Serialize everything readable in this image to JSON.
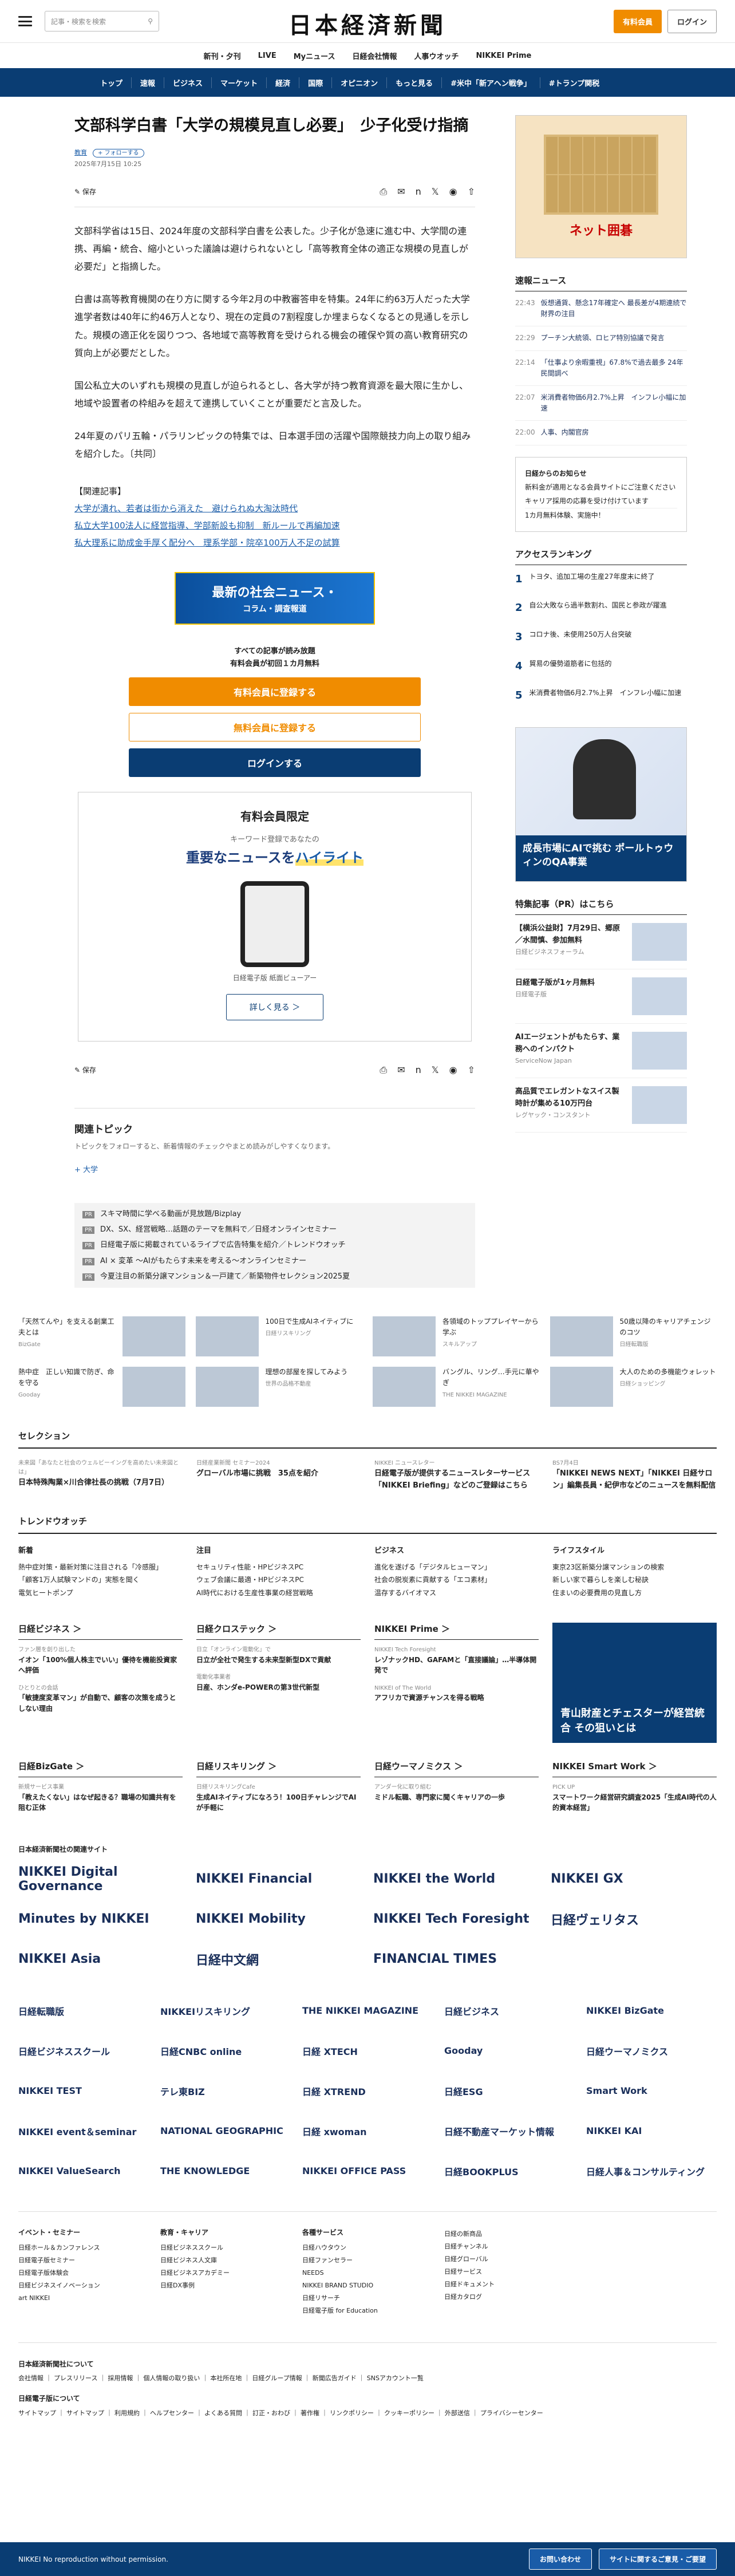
{
  "header": {
    "search_placeholder": "記事・検索を検索",
    "logo": "日本経済新聞",
    "signup": "有料会員",
    "login": "ログイン"
  },
  "subnav": [
    "新刊・夕刊",
    "LIVE",
    "Myニュース",
    "日経会社情報",
    "人事ウオッチ",
    "NIKKEI Prime"
  ],
  "mainnav": [
    "トップ",
    "速報",
    "ビジネス",
    "マーケット",
    "経済",
    "国際",
    "オピニオン",
    "もっと見る",
    "#米中「新アヘン戦争」",
    "#トランプ関税"
  ],
  "article": {
    "title": "文部科学白書「大学の規模見直し必要」　少子化受け指摘",
    "tag": "教育",
    "follow": "+ フォローする",
    "date": "2025年7月15日 10:25",
    "save": "保存",
    "paras": [
      "文部科学省は15日、2024年度の文部科学白書を公表した。少子化が急速に進む中、大学間の連携、再編・統合、縮小といった議論は避けられないとし「高等教育全体の適正な規模の見直しが必要だ」と指摘した。",
      "白書は高等教育機関の在り方に関する今年2月の中教審答申を特集。24年に約63万人だった大学進学者数は40年に約46万人となり、現在の定員の7割程度しか埋まらなくなるとの見通しを示した。規模の適正化を図りつつ、各地域で高等教育を受けられる機会の確保や質の高い教育研究の質向上が必要だとした。",
      "国公私立大のいずれも規模の見直しが迫られるとし、各大学が持つ教育資源を最大限に生かし、地域や設置者の枠組みを超えて連携していくことが重要だと言及した。",
      "24年夏のパリ五輪・パラリンピックの特集では、日本選手団の活躍や国際競技力向上の取り組みを紹介した。〔共同〕"
    ],
    "related_title": "【関連記事】",
    "related": [
      "大学が潰れ、若者は街から消えた　避けられぬ大淘汰時代",
      "私立大学100法人に経営指導、学部新設も抑制　新ルールで再編加速",
      "私大理系に助成金手厚く配分へ　理系学部・院卒100万人不足の試算"
    ]
  },
  "banner": {
    "title": "最新の社会ニュース・",
    "sub": "コラム・調査報道"
  },
  "paywall": {
    "line1": "すべての記事が読み放題",
    "line2": "有料会員が初回１カ月無料",
    "b1": "有料会員に登録する",
    "b2": "無料会員に登録する",
    "b3": "ログインする"
  },
  "digital": {
    "title": "有料会員限定",
    "sub": "キーワード登録であなたの",
    "hl1": "重要なニュースを",
    "hl2": "ハイライト",
    "cap": "日経電子版 紙面ビューアー",
    "more": "詳しく見る ＞"
  },
  "topics": {
    "title": "関連トピック",
    "desc": "トピックをフォローすると、新着情報のチェックやまとめ読みがしやすくなります。",
    "follow": "+ 大学"
  },
  "promos": [
    "スキマ時間に学べる動画が見放題/Bizplay",
    "DX、SX、経営戦略…話題のテーマを無料で／日経オンラインセミナー",
    "日経電子版に掲載されているライブで広告特集を紹介／トレンドウオッチ",
    "AI × 変革 ～AIがもたらす未来を考える～オンラインセミナー",
    "今夏注目の新築分譲マンション＆一戸建て／新築物件セレクション2025夏"
  ],
  "sidebar": {
    "ad1": "ネット囲碁",
    "news_title": "速報ニュース",
    "news": [
      [
        "22:43",
        "仮想通貨、懸念17年確定へ 最長差が4期連続で財界の注目"
      ],
      [
        "22:29",
        "プーチン大統領、ロヒア特別協議で発言"
      ],
      [
        "22:14",
        "「仕事より余暇重視」67.8%で過去最多 24年民間調べ"
      ],
      [
        "22:07",
        "米消費者物価6月2.7%上昇　インフレ小幅に加速"
      ],
      [
        "22:00",
        "人事、内閣官房"
      ]
    ],
    "notice": [
      "日経からのお知らせ",
      "新料金が適用となる会員サイトにご注意ください",
      "キャリア採用の応募を受け付けています",
      "1カ月無料体験、実施中！"
    ],
    "rank_title": "アクセスランキング",
    "rank": [
      "トヨタ、追加工場の生産27年度末に終了",
      "自公大敗なら過半数割れ、国民と参政が躍進",
      "コロナ後、未使用250万人台突破",
      "貿易の優勢道筋者に包括的",
      "米消費者物価6月2.7%上昇　インフレ小幅に加速"
    ],
    "ad2": "成長市場にAIで挑む ポールトゥウィンのQA事業",
    "pr_title": "特集記事（PR）はこちら",
    "pr": [
      [
        "【横浜公益財】7月29日、郷原／水間慎、参加無料",
        "日経ビジネスフォーラム"
      ],
      [
        "日経電子版が1ヶ月無料",
        "日経電子版"
      ],
      [
        "AIエージェントがもたらす、業務へのインパクト",
        "ServiceNow Japan"
      ],
      [
        "高品質でエレガントなスイス製時計が集める10万円台",
        "レグヤック・コンスタント"
      ]
    ]
  },
  "cards": [
    [
      "「天然てんや」を支える創業工夫とは",
      "BizGate"
    ],
    [
      "100日で生成AIネイティブに",
      "日経リスキリング"
    ],
    [
      "各領域のトッププレイヤーから学ぶ",
      "スキルアップ"
    ],
    [
      "50歳以降のキャリアチェンジのコツ",
      "日経転職版"
    ],
    [
      "熱中症　正しい知識で防ぎ、命を守る",
      "Gooday"
    ],
    [
      "理想の部屋を探してみよう",
      "世界の品格不動産"
    ],
    [
      "バングル、リング…手元に華やぎ",
      "THE NIKKEI MAGAZINE"
    ],
    [
      "大人のための多機能ウォレット",
      "日経ショッピング"
    ]
  ],
  "selection": {
    "title": "セレクション",
    "items": [
      [
        "未来図「あなたと社会のウェルビーイングを高めたい未来図とは」",
        "日本特殊陶業×川合律社長の挑戦（7月7日）"
      ],
      [
        "日経産業新聞 セミナー2024",
        "グローバル市場に挑戦　35点を紹介"
      ],
      [
        "NIKKEI ニュースレター",
        "日経電子版が提供するニュースレターサービス「NIKKEI Briefing」などのご登録はこちら"
      ],
      [
        "BS7月4日",
        "「NIKKEI NEWS NEXT」「NIKKEI 日経サロン」編集長員・紀伊市などのニュースを無料配信"
      ]
    ]
  },
  "trend": {
    "title": "トレンドウオッチ",
    "cols": [
      [
        "新着",
        "熱中症対策・最新対策に注目される「冷感服」",
        "「顧客1万人試験マンドの」実態を聞く",
        "電気ヒートポンプ"
      ],
      [
        "注目",
        "セキュリティ性能・HPビジネスPC",
        "ウェブ会議に最適・HPビジネスPC",
        "AI時代における生産性事業の経営戦略"
      ],
      [
        "ビジネス",
        "進化を遂げる「デジタルヒューマン」",
        "社会の脱炭素に貢献する「エコ素材」",
        "温存するバイオマス"
      ],
      [
        "ライフスタイル",
        "東京23区新築分譲マンションの検索",
        "新しい家で暮らしを楽しむ秘訣",
        "住まいの必要費用の見直し方"
      ]
    ]
  },
  "grid4": [
    {
      "title": "日経ビジネス ＞",
      "items": [
        [
          "ファン層を創り出した",
          "イオン「100%個人株主でいい」優待を機能投資家へ評価"
        ],
        [
          "ひとりとの会話",
          "「敏捷度変革マン」が自動で、顧客の次策を成うとしない理由"
        ]
      ]
    },
    {
      "title": "日経クロステック ＞",
      "items": [
        [
          "日立「オンライン電動化」で",
          "日立が全社で発生する未来型新型DXで貢献"
        ],
        [
          "電動化事業者",
          "日産、ホンダe-POWERの第3世代新型"
        ]
      ]
    },
    {
      "title": "NIKKEI Prime ＞",
      "items": [
        [
          "NIKKEI Tech Foresight",
          "レゾナックHD、GAFAMと「直接議論」…半導体開発で"
        ],
        [
          "NIKKEI of The World",
          "アフリカで資源チャンスを得る戦略"
        ]
      ]
    },
    {
      "title": "",
      "items": []
    }
  ],
  "adsq": "青山財産とチェスターが経営統合 その狙いとは",
  "grid4b": [
    {
      "title": "日経BizGate ＞",
      "items": [
        [
          "新規サービス事業",
          "「教えたくない」はなぜ起きる？職場の知識共有を阻む正体"
        ]
      ]
    },
    {
      "title": "日経リスキリング ＞",
      "items": [
        [
          "日経リスキリングCafe",
          "生成AIネイティブになろう！100日チャレンジでAIが手軽に"
        ]
      ]
    },
    {
      "title": "日経ウーマノミクス ＞",
      "items": [
        [
          "アンダー化に取り組む",
          "ミドル転職、専門家に聞くキャリアの一歩"
        ]
      ]
    },
    {
      "title": "NIKKEI Smart Work ＞",
      "items": [
        [
          "PICK UP",
          "スマートワーク経営研究調査2025「生成AI時代の人的資本経営」"
        ]
      ]
    }
  ],
  "logos_title": "日本経済新聞社の関連サイト",
  "logos": [
    "NIKKEI Digital Governance",
    "NIKKEI Financial",
    "NIKKEI the World",
    "NIKKEI GX",
    "Minutes by NIKKEI",
    "NIKKEI Mobility",
    "NIKKEI Tech Foresight",
    "日経ヴェリタス",
    "NIKKEI Asia",
    "日経中文網",
    "FINANCIAL TIMES",
    ""
  ],
  "logos2": [
    "日経転職版",
    "NIKKEIリスキリング",
    "THE NIKKEI MAGAZINE",
    "日経ビジネス",
    "NIKKEI BizGate",
    "日経ビジネススクール",
    "日経CNBC online",
    "日経 XTECH",
    "Gooday",
    "日経ウーマノミクス",
    "NIKKEI TEST",
    "テレ東BIZ",
    "日経 XTREND",
    "日経ESG",
    "Smart Work",
    "NIKKEI event＆seminar",
    "NATIONAL GEOGRAPHIC",
    "日経 xwoman",
    "日経不動産マーケット情報",
    "NIKKEI KAI",
    "NIKKEI ValueSearch",
    "THE KNOWLEDGE",
    "NIKKEI OFFICE PASS",
    "日経BOOKPLUS",
    "日経人事＆コンサルティング"
  ],
  "flinks": [
    {
      "t": "イベント・セミナー",
      "l": [
        "日経ホール＆カンファレンス",
        "日経電子版セミナー",
        "日経電子版体験会",
        "日経ビジネスイノベーション",
        "art NIKKEI"
      ]
    },
    {
      "t": "教育・キャリア",
      "l": [
        "日経ビジネススクール",
        "日経ビジネス人文庫",
        "日経ビジネスアカデミー",
        "日経DX事例"
      ]
    },
    {
      "t": "各種サービス",
      "l": [
        "日経ハウタウン",
        "日経ファンセラー",
        "NEEDS",
        "NIKKEI BRAND STUDIO",
        "日経リサーチ",
        "日経電子版 for Education"
      ]
    },
    {
      "t": "",
      "l": [
        "日経の新商品",
        "日経チャンネル",
        "日経グローバル",
        "日経サービス",
        "日経ドキュメント",
        "日経カタログ"
      ]
    },
    {
      "t": "",
      "l": []
    }
  ],
  "bottom": {
    "t1": "日本経済新聞社について",
    "l1": "会社情報 ｜ プレスリリース ｜ 採用情報 ｜ 個人情報の取り扱い ｜ 本社所在地 ｜ 日経グループ情報 ｜ 新聞広告ガイド ｜ SNSアカウント一覧",
    "t2": "日経電子版について",
    "l2": "サイトマップ ｜ サイトマップ ｜ 利用規約 ｜ ヘルプセンター ｜ よくある質問 ｜ 訂正・おわび ｜ 著作権 ｜ リンクポリシー ｜ クッキーポリシー ｜ 外部送信 ｜ プライバシーセンター"
  },
  "footer": {
    "copy": "NIKKEI  No reproduction without permission.",
    "b1": "お問い合わせ",
    "b2": "サイトに関するご意見・ご要望"
  }
}
